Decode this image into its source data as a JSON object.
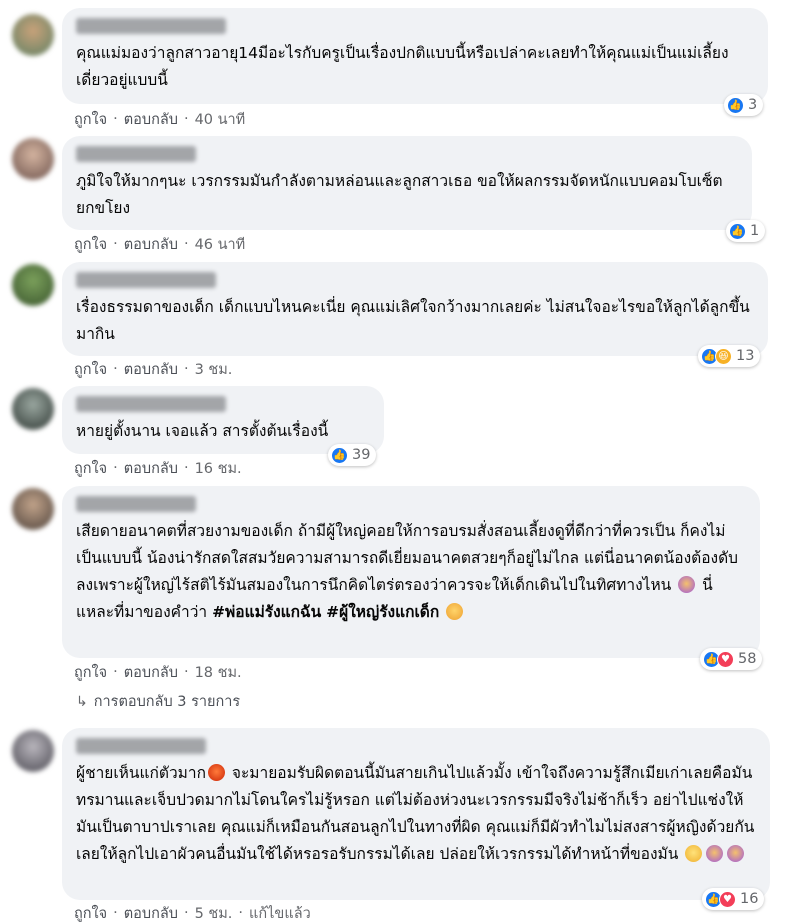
{
  "comments": [
    {
      "text": "คุณแม่มองว่าลูกสาวอายุ14มีอะไรกับครูเป็นเรื่องปกติแบบนี้หรือเปล่าคะเลยทำให้คุณแม่เป็นแม่เลี้ยงเดี่ยวอยู่แบบนี้",
      "like": "ถูกใจ",
      "reply": "ตอบกลับ",
      "time": "40 นาที",
      "reaction_count": "3"
    },
    {
      "text": "ภูมิใจให้มากๆนะ เวรกรรมมันกำลังตามหล่อนและลูกสาวเธอ ขอให้ผลกรรมจัดหนักแบบคอมโบเซ็ตยกขโยง",
      "like": "ถูกใจ",
      "reply": "ตอบกลับ",
      "time": "46 นาที",
      "reaction_count": "1"
    },
    {
      "text": "เรื่องธรรมดาของเด็ก เด็กแบบไหนคะเนี่ย คุณแม่เลิศใจกว้างมากเลยค่ะ ไม่สนใจอะไรขอให้ลูกได้ลูกขึ้นมากิน",
      "like": "ถูกใจ",
      "reply": "ตอบกลับ",
      "time": "3 ชม.",
      "reaction_count": "13"
    },
    {
      "text": "หายยู่ตั้งนาน เจอแล้ว สารตั้งต้นเรื่องนี้",
      "like": "ถูกใจ",
      "reply": "ตอบกลับ",
      "time": "16 ชม.",
      "reaction_count": "39"
    },
    {
      "text_part1": "เสียดายอนาคตที่สวยงามของเด็ก ถ้ามีผู้ใหญ่คอยให้การอบรมสั่งสอนเลี้ยงดูที่ดีกว่าที่ควรเป็น ก็คงไม่เป็นแบบนี้ น้องน่ารักสดใสสมวัยความสามารถดีเยี่ยมอนาคตสวยๆก็อยู่ไม่ไกล แต่นี่อนาคตน้องต้องดับลงเพราะผู้ใหญ่ไร้สติไร้มันสมองในการนึกคิดไตร่ตรองว่าควรจะให้เด็กเดินไปในทิศทางไหน",
      "text_part2": " นี่แหละที่มาของคำว่า ",
      "hashtag1": "#พ่อแม่รังแกฉัน",
      "hashtag2": "#ผู้ใหญ่รังแกเด็ก",
      "like": "ถูกใจ",
      "reply": "ตอบกลับ",
      "time": "18 ชม.",
      "reaction_count": "58",
      "replies_label": "การตอบกลับ 3 รายการ"
    },
    {
      "text_part1": "ผู้ชายเห็นแก่ตัวมาก",
      "text_part2": " จะมายอมรับผิดตอนนี้มันสายเกินไปแล้วมั้ง เข้าใจถึงความรู้สึกเมียเก่าเลยคือมันทรมานและเจ็บปวดมากไม่โดนใครไม่รู้หรอก แต่ไม่ต้องห่วงนะเวรกรรมมีจริงไม่ช้าก็เร็ว อย่าไปแช่งให้มันเป็นตาบาปเราเลย คุณแม่ก็เหมือนกันสอนลูกไปในทางที่ผิด คุณแม่ก็มีผัวทำไมไม่สงสารผู้หญิงด้วยกันเลยให้ลูกไปเอาผัวคนอื่นมันใช้ได้หรอรอรับกรรมได้เลย ปล่อยให้เวรกรรมได้ทำหน้าที่ของมัน",
      "like": "ถูกใจ",
      "reply": "ตอบกลับ",
      "time": "5 ชม.",
      "edited": "แก้ไขแล้ว",
      "reaction_count": "16"
    }
  ],
  "colors": {
    "bubble": "#f0f2f5",
    "like_blue": "#1877f2",
    "haha_yellow": "#f7b125",
    "love_red": "#f33e58",
    "meta_gray": "#65676b"
  }
}
